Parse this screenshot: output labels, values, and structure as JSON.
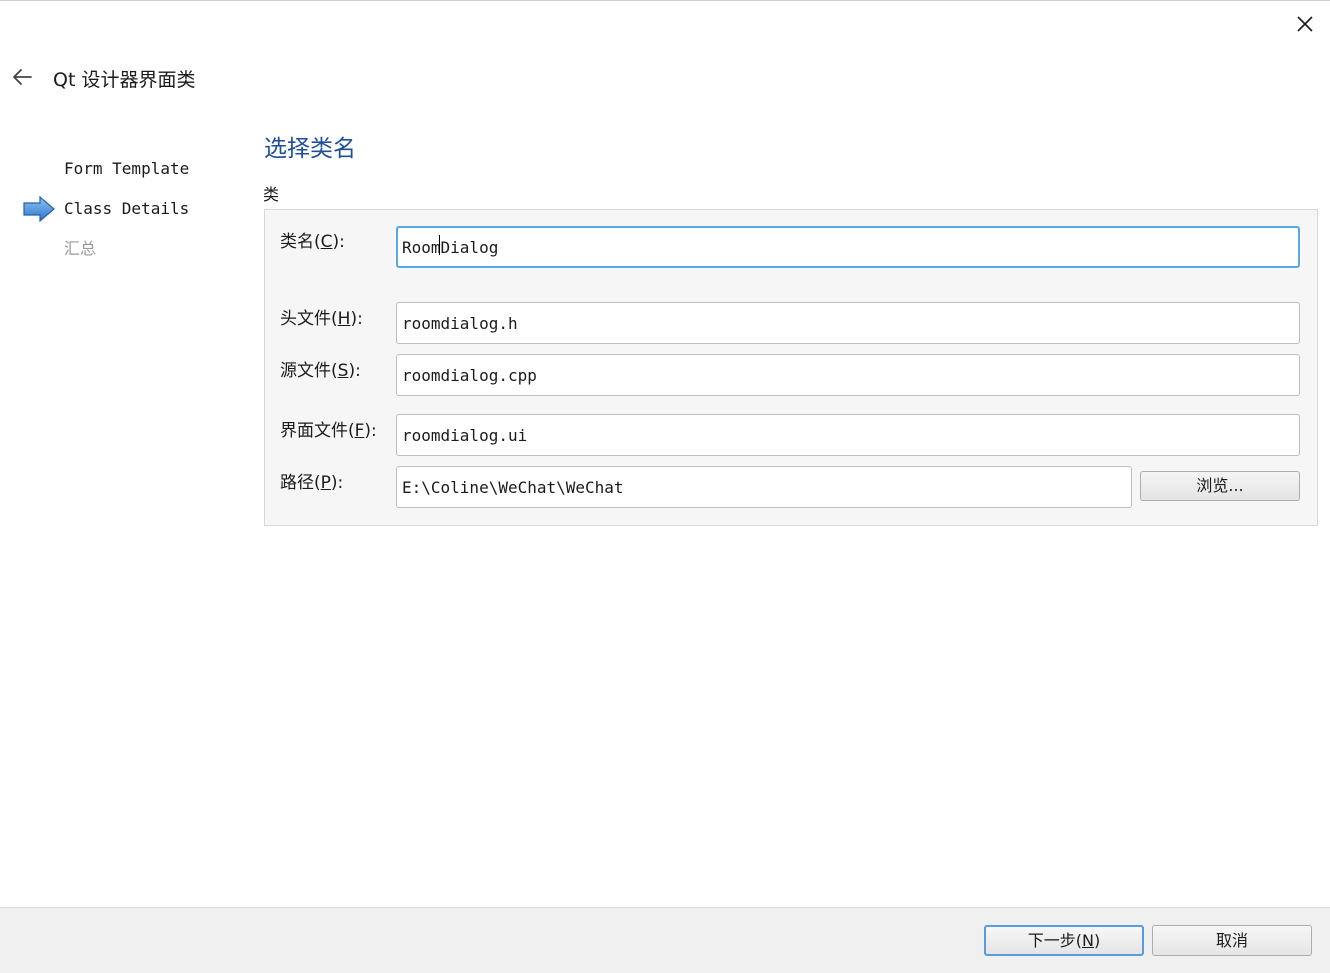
{
  "window": {
    "title": "Qt 设计器界面类"
  },
  "steps": [
    {
      "label": "Form Template",
      "state": "done"
    },
    {
      "label": "Class Details",
      "state": "current"
    },
    {
      "label": "汇总",
      "state": "pending"
    }
  ],
  "page": {
    "title": "选择类名",
    "group_label": "类"
  },
  "fields": {
    "class_name": {
      "label": "类名(",
      "mnemonic": "C",
      "suffix": "):",
      "value": "RoomDialog"
    },
    "header_file": {
      "label": "头文件(",
      "mnemonic": "H",
      "suffix": "):",
      "value": "roomdialog.h"
    },
    "source_file": {
      "label": "源文件(",
      "mnemonic": "S",
      "suffix": "):",
      "value": "roomdialog.cpp"
    },
    "form_file": {
      "label": "界面文件(",
      "mnemonic": "F",
      "suffix": "):",
      "value": "roomdialog.ui"
    },
    "path": {
      "label": "路径(",
      "mnemonic": "P",
      "suffix": "):",
      "value": "E:\\Coline\\WeChat\\WeChat"
    }
  },
  "buttons": {
    "browse": "浏览...",
    "next": "下一步(",
    "next_mnemonic": "N",
    "next_suffix": ")",
    "cancel": "取消"
  },
  "colors": {
    "accent": "#1f4e9a",
    "focus": "#5aa6e6",
    "step_arrow": "#3b82d6"
  },
  "icons": {
    "close": "close-icon",
    "back": "back-arrow-icon",
    "current_step": "step-arrow-icon"
  }
}
